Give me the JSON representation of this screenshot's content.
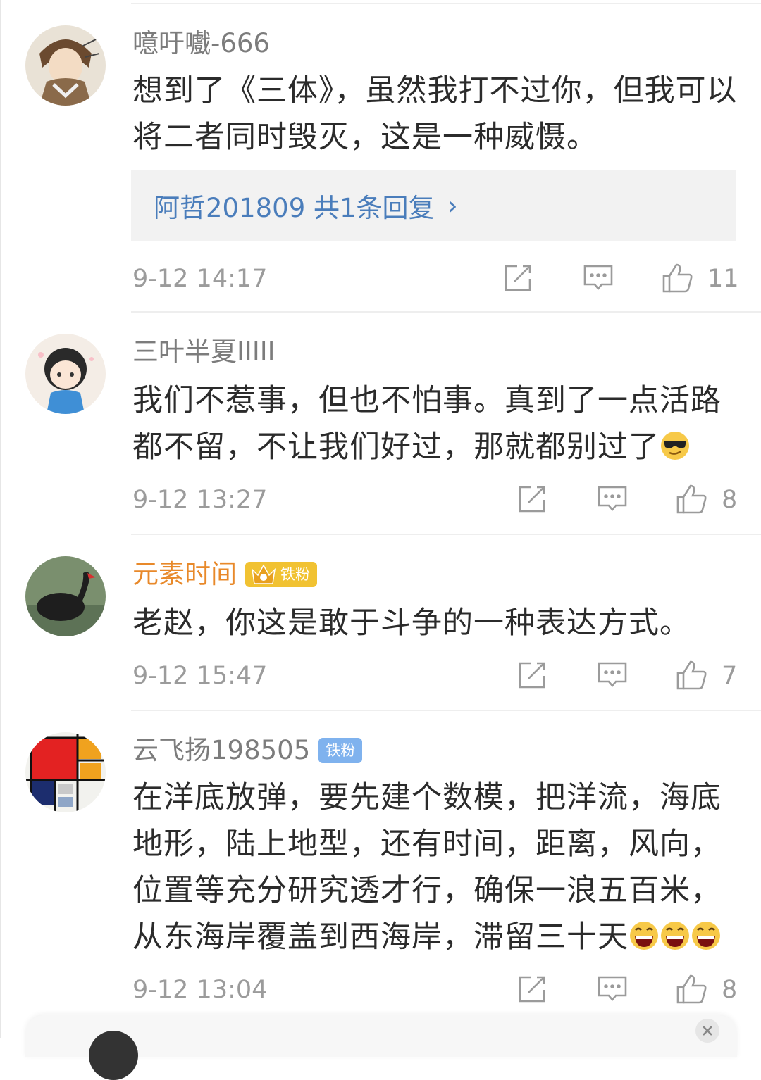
{
  "comments": [
    {
      "username": "噫吁嚱-666",
      "text": "想到了《三体》，虽然我打不过你，但我可以将二者同时毁灭，这是一种威慑。",
      "reply": {
        "text": "阿哲201809 共1条回复",
        "chevron": "›"
      },
      "time": "9-12 14:17",
      "likes": "11"
    },
    {
      "username": "三叶半夏IIIII",
      "text": "我们不惹事，但也不怕事。真到了一点活路都不留，不让我们好过，那就都别过了",
      "emoji": [
        "sunglasses-emoji"
      ],
      "time": "9-12 13:27",
      "likes": "8"
    },
    {
      "username": "元素时间",
      "username_color": "#e8892a",
      "badge": "铁粉",
      "badge_style": "gold-crown",
      "text": "老赵，你这是敢于斗争的一种表达方式。",
      "time": "9-12 15:47",
      "likes": "7"
    },
    {
      "username": "云飞扬198505",
      "badge": "铁粉",
      "badge_style": "blue",
      "text": "在洋底放弹，要先建个数模，把洋流，海底地形，陆上地型，还有时间，距离，风向，位置等充分研究透才行，确保一浪五百米，从东海岸覆盖到西海岸，滞留三十天",
      "emoji": [
        "grin-emoji",
        "grin-emoji",
        "grin-emoji"
      ],
      "time": "9-12 13:04",
      "likes": "8"
    }
  ],
  "icons": {
    "share": "share-icon",
    "comment": "comment-icon",
    "like": "thumbs-up-icon",
    "close": "close-icon"
  },
  "colors": {
    "username": "#7c7c7c",
    "username_vip": "#e8892a",
    "link": "#4a7dbb",
    "meta": "#9b9b9b",
    "badge_blue": "#7fb2ee",
    "badge_gold": "#f1c232"
  }
}
